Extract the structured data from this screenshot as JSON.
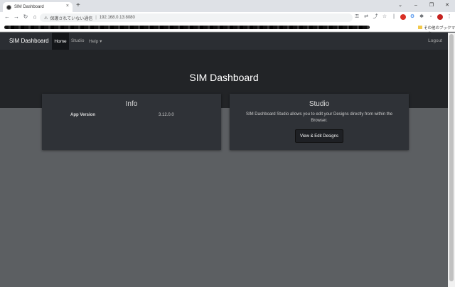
{
  "browser": {
    "tab_title": "SIM Dashboard",
    "tab_close": "×",
    "new_tab": "+",
    "window_controls": [
      "⌄",
      "–",
      "❐",
      "✕"
    ],
    "security_text": "保護されていない通信",
    "url": "192.168.0.13:8080",
    "bookmarks_folder": "その他のブックマーク"
  },
  "navbar": {
    "brand": "SIM Dashboard",
    "home": "Home",
    "studio": "Studio",
    "help": "Help ▾",
    "logout": "Logout"
  },
  "hero": {
    "title": "SIM Dashboard"
  },
  "info_card": {
    "title": "Info",
    "app_version_label": "App Version",
    "app_version_value": "3.12.0.0"
  },
  "studio_card": {
    "title": "Studio",
    "description": "SIM Dashboard Studio allows you to edit your Designs directly from within the Browser.",
    "button_label": "View & Edit Designs"
  },
  "colors": {
    "navbar_bg": "#2b2e33",
    "hero_bg": "#222427",
    "page_bg": "#5c5f62",
    "card_bg": "#2f3237"
  }
}
